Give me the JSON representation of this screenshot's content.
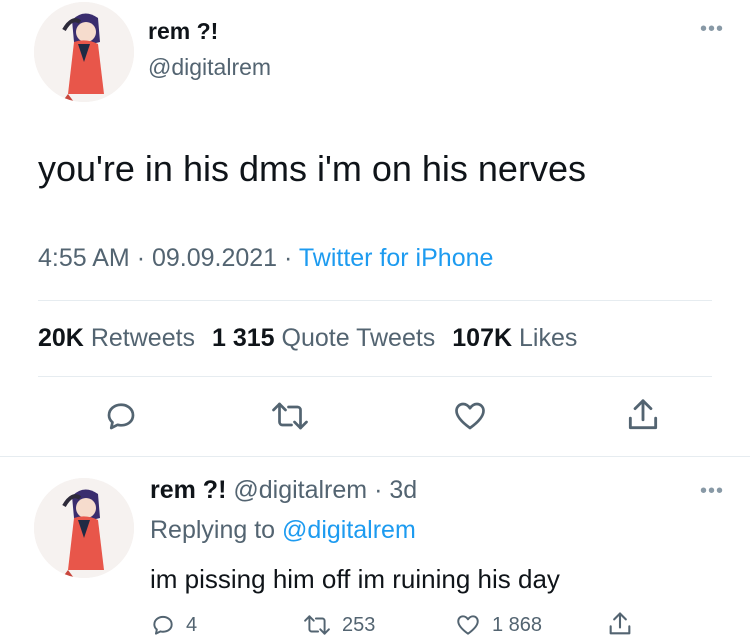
{
  "main_tweet": {
    "display_name": "rem ?!",
    "handle": "@digitalrem",
    "text": "you're in his dms i'm on his nerves",
    "time": "4:55 AM",
    "date": "09.09.2021",
    "source": "Twitter for iPhone",
    "sep": "·",
    "stats": {
      "retweets_count": "20K",
      "retweets_label": "Retweets",
      "quotes_count": "1 315",
      "quotes_label": "Quote Tweets",
      "likes_count": "107K",
      "likes_label": "Likes"
    },
    "icons": {
      "more": "more-icon",
      "reply": "reply-icon",
      "retweet": "retweet-icon",
      "like": "heart-icon",
      "share": "share-icon"
    }
  },
  "reply_tweet": {
    "display_name": "rem ?!",
    "handle": "@digitalrem",
    "sep": "·",
    "age": "3d",
    "replying_prefix": "Replying to",
    "replying_handle": "@digitalrem",
    "text": "im pissing him off im ruining his day",
    "reply_count": "4",
    "retweet_count": "253",
    "like_count": "1 868"
  },
  "colors": {
    "link_blue": "#1d9bf0",
    "muted_gray": "#536471",
    "divider": "#e6ecf0"
  }
}
